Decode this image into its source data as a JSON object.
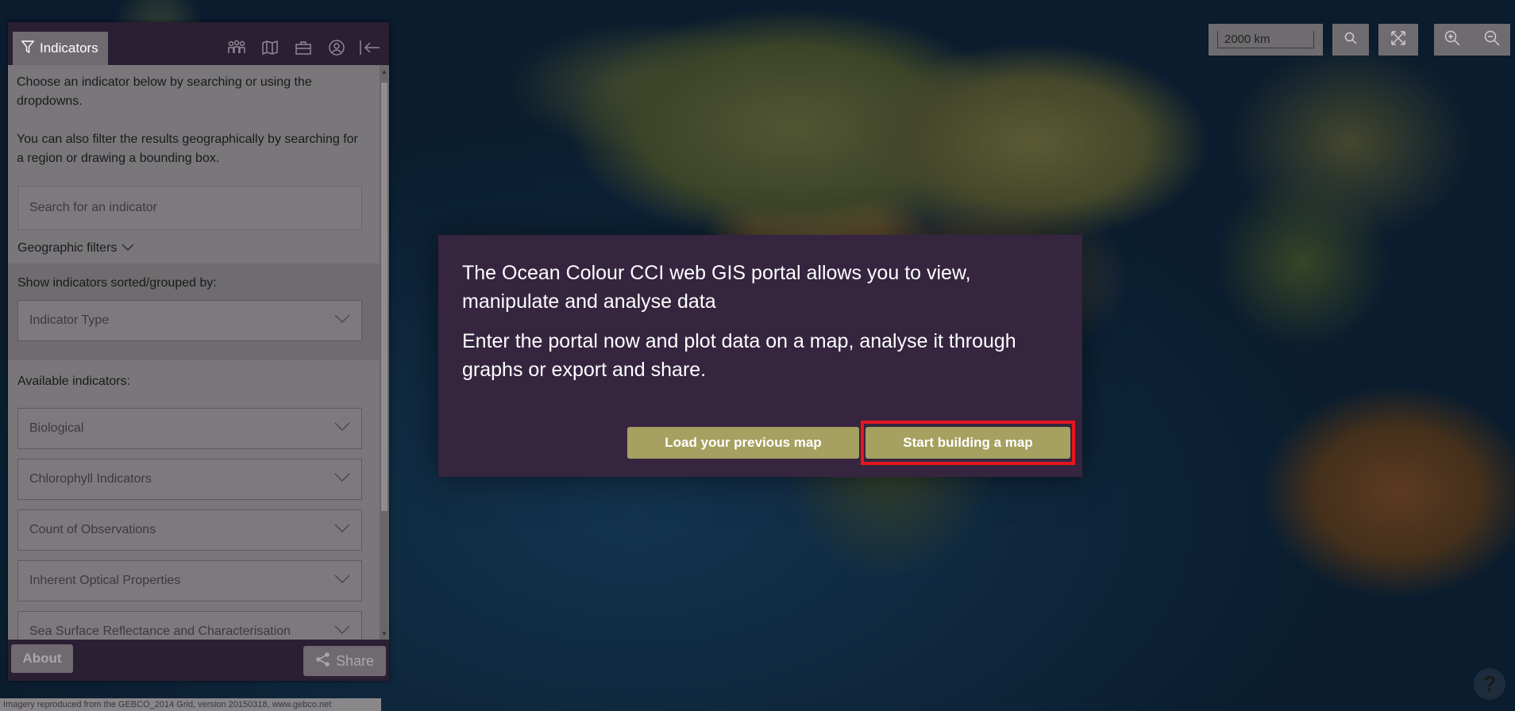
{
  "panel": {
    "tab_label": "Indicators",
    "intro_1": "Choose an indicator below by searching or using the dropdowns.",
    "intro_2": "You can also filter the results geographically by searching for a region or drawing a bounding box.",
    "search_placeholder": "Search for an indicator",
    "geo_filters_label": "Geographic filters",
    "sort_label": "Show indicators sorted/grouped by:",
    "sort_value": "Indicator Type",
    "available_label": "Available indicators:",
    "indicators": [
      "Biological",
      "Chlorophyll Indicators",
      "Count of Observations",
      "Inherent Optical Properties",
      "Sea Surface Reflectance and Characterisation"
    ],
    "about_label": "About",
    "share_label": "Share",
    "header_icons": [
      "people-icon",
      "map-icon",
      "briefcase-icon",
      "user-icon",
      "collapse-icon"
    ]
  },
  "map": {
    "scale_label": "2000 km",
    "attribution": "Imagery reproduced from the GEBCO_2014 Grid, version 20150318, www.gebco.net",
    "help_label": "?"
  },
  "modal": {
    "line_1": "The Ocean Colour CCI web GIS portal allows you to view, manipulate and analyse data",
    "line_2": "Enter the portal now and plot data on a map, analyse it through graphs or export and share.",
    "load_label": "Load your previous map",
    "start_label": "Start building a map"
  },
  "colors": {
    "modal_bg": "#35253f",
    "button_bg": "#a6a061",
    "highlight": "#e4171e",
    "panel_dark": "#2a1f33"
  }
}
